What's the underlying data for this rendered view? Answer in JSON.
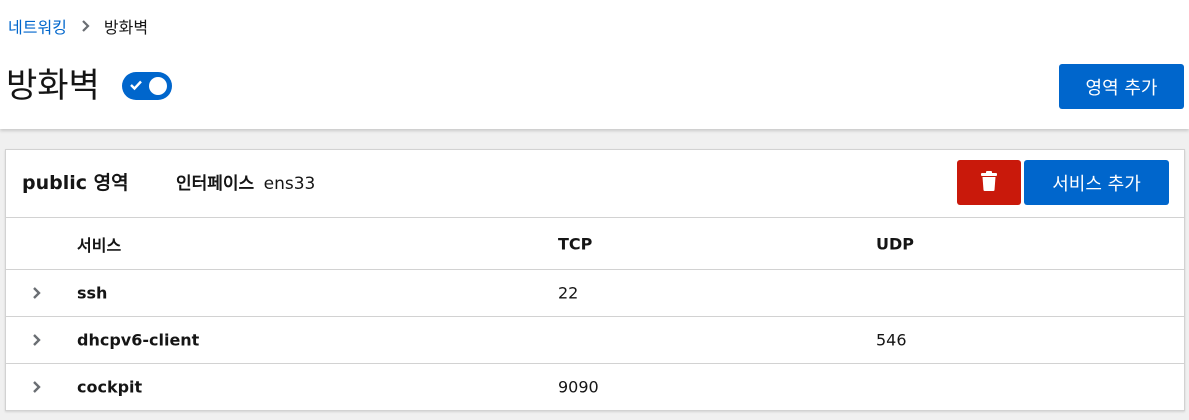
{
  "breadcrumb": {
    "parent": "네트워킹",
    "current": "방화벽"
  },
  "page": {
    "title": "방화벽",
    "firewall_enabled": true,
    "add_zone_label": "영역 추가"
  },
  "zone": {
    "title": "public 영역",
    "interface_label": "인터페이스",
    "interface_value": "ens33",
    "delete_icon": "trash-icon",
    "add_service_label": "서비스 추가"
  },
  "table": {
    "columns": [
      "서비스",
      "TCP",
      "UDP"
    ],
    "rows": [
      {
        "name": "ssh",
        "tcp": "22",
        "udp": ""
      },
      {
        "name": "dhcpv6-client",
        "tcp": "",
        "udp": "546"
      },
      {
        "name": "cockpit",
        "tcp": "9090",
        "udp": ""
      }
    ]
  },
  "colors": {
    "primary": "#0066cc",
    "danger": "#c9190b",
    "link": "#0066cc"
  }
}
